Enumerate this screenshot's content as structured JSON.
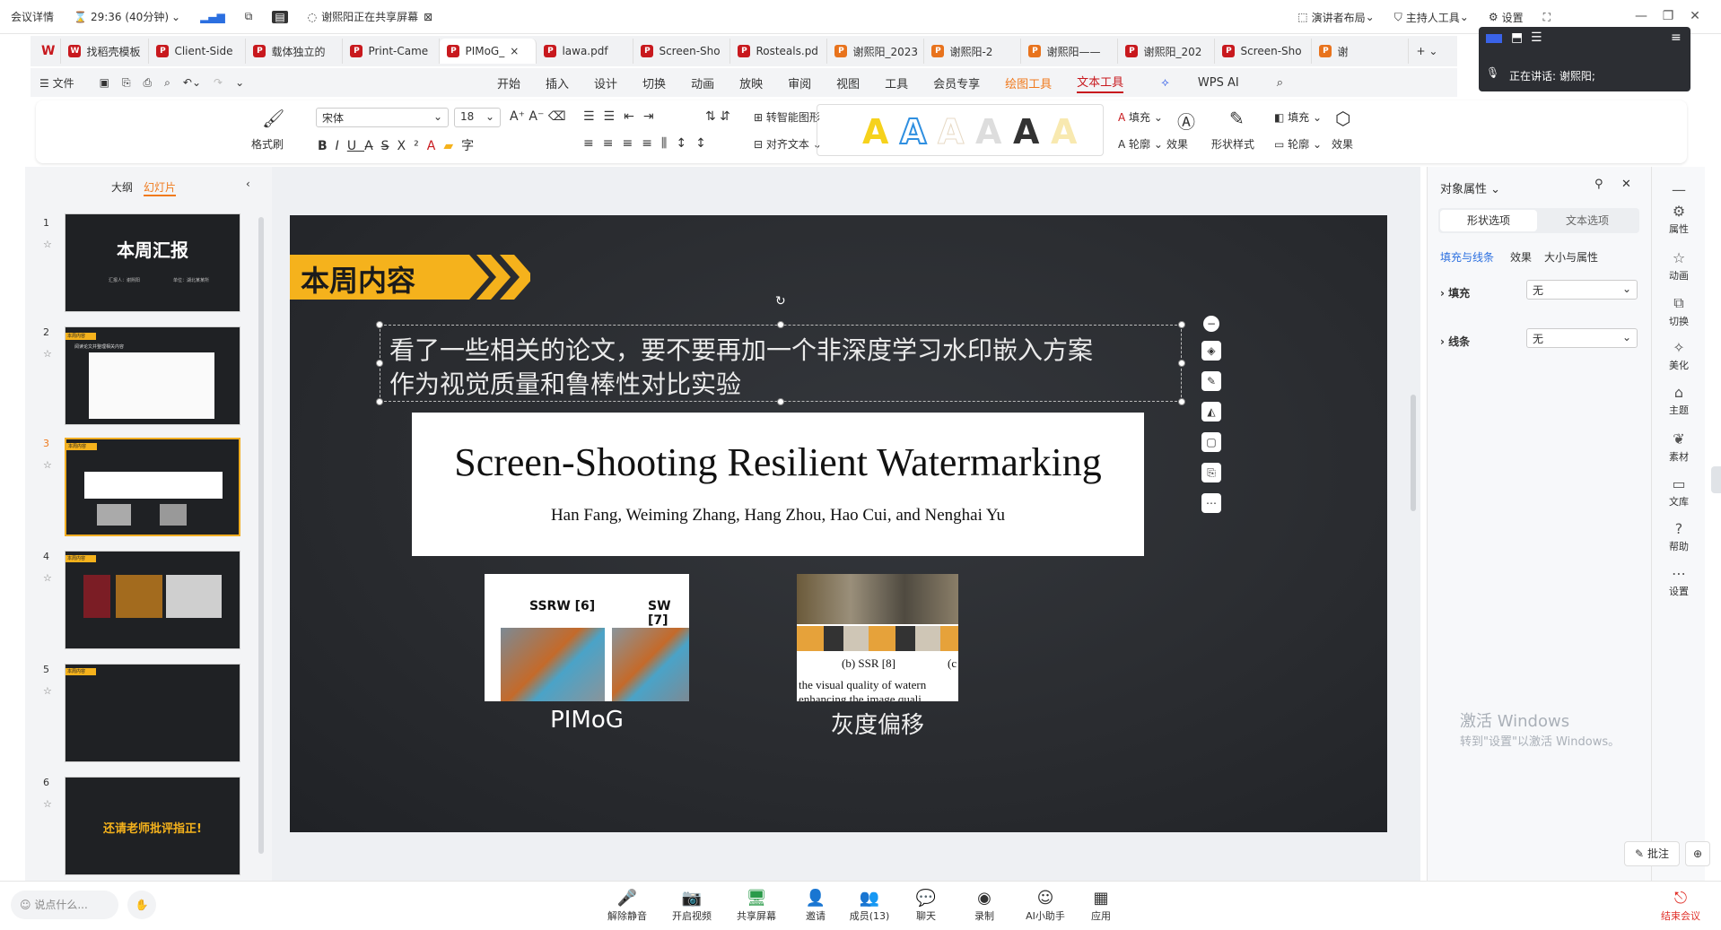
{
  "meeting": {
    "details": "会议详情",
    "timer": "29:36 (40分钟)",
    "sharing_status": "谢熙阳正在共享屏幕",
    "presenter_layout": "演讲者布局",
    "host_tools": "主持人工具",
    "settings": "设置"
  },
  "tabs": [
    {
      "label": "找稻壳模板",
      "color": "#c8191e",
      "icon_text": "W"
    },
    {
      "label": "Client-Side",
      "color": "#c8191e",
      "icon_text": "P"
    },
    {
      "label": "载体独立的",
      "color": "#c8191e",
      "icon_text": "P"
    },
    {
      "label": "Print-Came",
      "color": "#c8191e",
      "icon_text": "P"
    },
    {
      "label": "PIMoG_",
      "color": "#c8191e",
      "icon_text": "P"
    },
    {
      "label": "lawa.pdf",
      "color": "#c8191e",
      "icon_text": "P"
    },
    {
      "label": "Screen-Sho",
      "color": "#c8191e",
      "icon_text": "P"
    },
    {
      "label": "Rosteals.pd",
      "color": "#c8191e",
      "icon_text": "P"
    },
    {
      "label": "谢熙阳_2023",
      "color": "#e8731d",
      "icon_text": "P"
    },
    {
      "label": "谢熙阳-2",
      "color": "#e8731d",
      "icon_text": "P"
    },
    {
      "label": "谢熙阳——",
      "color": "#e8731d",
      "icon_text": "P"
    },
    {
      "label": "谢熙阳_202",
      "color": "#c8191e",
      "icon_text": "P"
    },
    {
      "label": "Screen-Sho",
      "color": "#c8191e",
      "icon_text": "P"
    },
    {
      "label": "谢",
      "color": "#e8731d",
      "icon_text": "P"
    }
  ],
  "menu": {
    "file": "文件",
    "items": [
      "开始",
      "插入",
      "设计",
      "切换",
      "动画",
      "放映",
      "审阅",
      "视图",
      "工具",
      "会员专享"
    ],
    "drawing_tools": "绘图工具",
    "text_tools": "文本工具",
    "wps_ai": "WPS AI"
  },
  "ribbon": {
    "format_painter": "格式刷",
    "font_name": "宋体",
    "font_size": "18",
    "smart_shape": "转智能图形",
    "align_text": "对齐文本",
    "fill": "填充",
    "outline": "轮廓",
    "effect": "效果",
    "shape_style": "形状样式",
    "fill2": "填充",
    "outline2": "轮廓",
    "effect2": "效果"
  },
  "left_panel": {
    "outline_tab": "大纲",
    "slides_tab": "幻灯片",
    "slides": [
      {
        "num": "1",
        "title": "本周汇报",
        "sub1": "汇报人：谢熙阳",
        "sub2": "单位：湖北某某所"
      },
      {
        "num": "2",
        "title": "本周内容",
        "text": "阅读论文并整理相关内容"
      },
      {
        "num": "3",
        "title": "本周内容"
      },
      {
        "num": "4",
        "title": "本周内容"
      },
      {
        "num": "5",
        "title": "本周内容"
      },
      {
        "num": "6",
        "title": "还请老师批评指正!"
      }
    ]
  },
  "slide": {
    "heading": "本周内容",
    "body_line1": "看了一些相关的论文，要不要再加一个非深度学习水印嵌入方案",
    "body_line2": "作为视觉质量和鲁棒性对比实验",
    "paper_title": "Screen-Shooting Resilient Watermarking",
    "paper_authors": "Han Fang, Weiming Zhang, Hang Zhou, Hao Cui, and Nenghai Yu",
    "img1_label_a": "SSRW [6]",
    "img1_label_b": "SW [7]",
    "img1_caption": "PIMoG",
    "img2_label": "(b) SSR [8]",
    "img2_label_c": "(c",
    "img2_text1": "the visual quality of watern",
    "img2_text2": "enhancing the image quali",
    "img2_caption": "灰度偏移"
  },
  "right_panel": {
    "title": "对象属性",
    "tab_shape": "形状选项",
    "tab_text": "文本选项",
    "sub_fill_line": "填充与线条",
    "sub_effect": "效果",
    "sub_size": "大小与属性",
    "fill_label": "填充",
    "fill_value": "无",
    "line_label": "线条",
    "line_value": "无"
  },
  "sidebar": [
    "属性",
    "动画",
    "切换",
    "美化",
    "主题",
    "素材",
    "文库",
    "帮助",
    "设置"
  ],
  "share_overlay": {
    "speaking_label": "正在讲话:",
    "speaker": "谢熙阳;"
  },
  "bottom": {
    "chat_placeholder": "说点什么...",
    "buttons": [
      "解除静音",
      "开启视频",
      "共享屏幕",
      "邀请",
      "成员(13)",
      "聊天",
      "录制",
      "AI小助手",
      "应用"
    ],
    "end": "结束会议",
    "annotate": "批注"
  },
  "watermark": {
    "line1": "激活 Windows",
    "line2": "转到\"设置\"以激活 Windows。"
  },
  "colors": {
    "accent_yellow": "#f5b21c",
    "wps_red": "#c8191e",
    "text_tools_red": "#c8191e",
    "drawing_orange": "#f07a1d"
  }
}
